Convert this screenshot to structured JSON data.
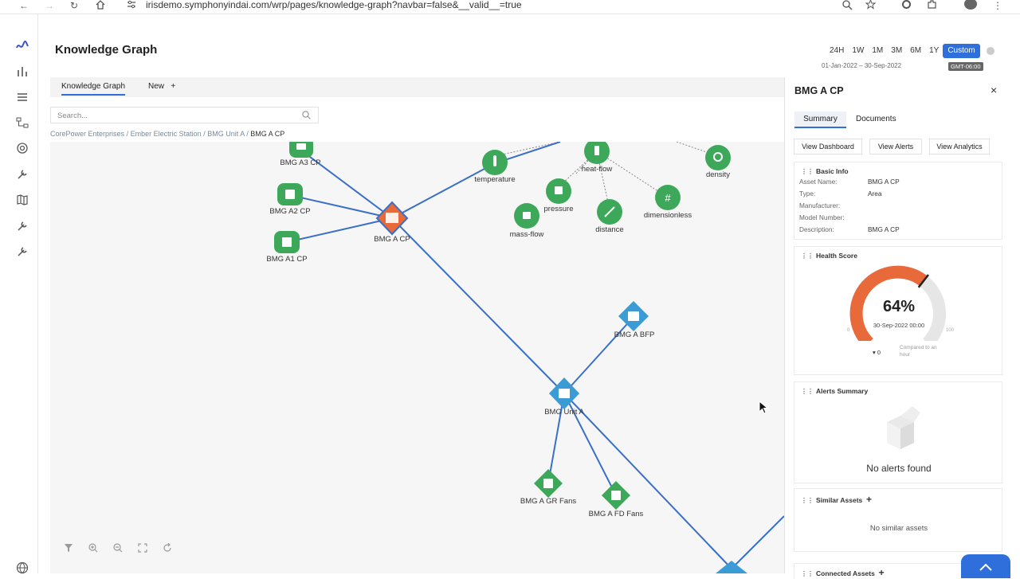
{
  "browser": {
    "url": "irisdemo.symphonyindai.com/wrp/pages/knowledge-graph?navbar=false&__valid__=true"
  },
  "header": {
    "title": "Knowledge Graph",
    "time_ranges": [
      "24H",
      "1W",
      "1M",
      "3M",
      "6M",
      "1Y",
      "Custom"
    ],
    "active_range": "Custom",
    "date_range": "01-Jan-2022 – 30-Sep-2022",
    "timezone": "GMT-06:00"
  },
  "tabs": {
    "knowledge_graph": "Knowledge Graph",
    "new": "New",
    "new_plus": "+"
  },
  "search": {
    "placeholder": "Search..."
  },
  "breadcrumb": {
    "items": [
      "CorePower Enterprises",
      "Ember Electric Station",
      "BMG Unit A"
    ],
    "separator": "/",
    "current": "BMG A CP"
  },
  "graph": {
    "nodes": {
      "bmg_a3_cp": "BMG A3 CP",
      "bmg_a2_cp": "BMG A2 CP",
      "bmg_a1_cp": "BMG A1 CP",
      "bmg_a_cp": "BMG A CP",
      "temperature": "temperature",
      "heat_flow": "heat-flow",
      "density": "density",
      "pressure": "pressure",
      "dimensionless": "dimensionless",
      "mass_flow": "mass-flow",
      "distance": "distance",
      "bmg_a_bfp": "BMG A BFP",
      "bmg_unit_a": "BMG Unit A",
      "bmg_a_gr_fans": "BMG A GR Fans",
      "bmg_a_fd_fans": "BMG A FD Fans"
    },
    "colors": {
      "asset": "#3ea85a",
      "unit": "#3a9bd5",
      "selected": "#e8693a",
      "edge": "#3a6fc9",
      "edge_dotted": "#777777"
    }
  },
  "panel": {
    "title": "BMG A CP",
    "close": "×",
    "tabs": {
      "summary": "Summary",
      "documents": "Documents"
    },
    "buttons": {
      "dashboard": "View Dashboard",
      "alerts": "View Alerts",
      "analytics": "View Analytics"
    },
    "basic_info": {
      "title": "Basic Info",
      "rows": [
        {
          "label": "Asset Name:",
          "value": "BMG A CP"
        },
        {
          "label": "Type:",
          "value": "Area"
        },
        {
          "label": "Manufacturer:",
          "value": ""
        },
        {
          "label": "Model Number:",
          "value": ""
        },
        {
          "label": "Description:",
          "value": "BMG A CP"
        }
      ]
    },
    "health": {
      "title": "Health Score",
      "score": 64,
      "score_text": "64%",
      "timestamp": "30-Sep-2022 00:00",
      "gauge_min": "0",
      "gauge_max": "100",
      "delta": "▾ 0",
      "compare": "Compared to an hour"
    },
    "alerts": {
      "title": "Alerts Summary",
      "empty": "No alerts found"
    },
    "similar": {
      "title": "Similar Assets",
      "add": "+",
      "empty": "No similar assets"
    },
    "connected": {
      "title": "Connected Assets",
      "add": "+"
    }
  }
}
